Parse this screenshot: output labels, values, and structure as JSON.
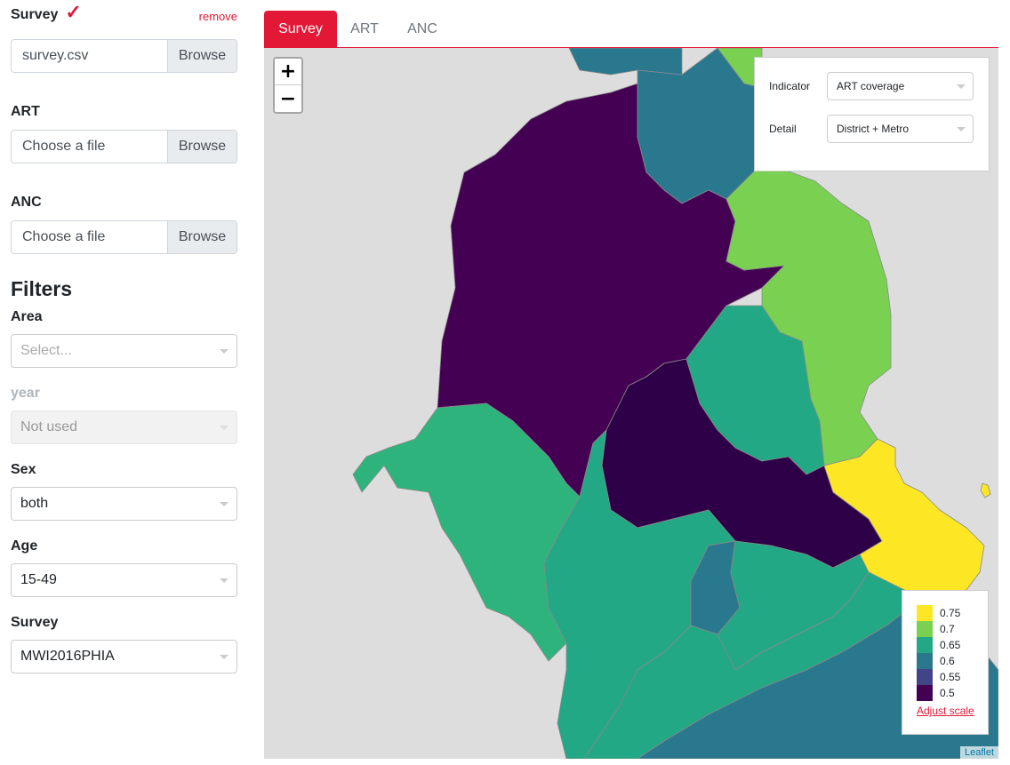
{
  "sidebar": {
    "survey": {
      "title": "Survey",
      "check": "✓",
      "remove": "remove",
      "file": "survey.csv",
      "browse": "Browse"
    },
    "art": {
      "title": "ART",
      "file": "Choose a file",
      "browse": "Browse"
    },
    "anc": {
      "title": "ANC",
      "file": "Choose a file",
      "browse": "Browse"
    },
    "filters_title": "Filters",
    "filters": {
      "area": {
        "label": "Area",
        "placeholder": "Select..."
      },
      "year": {
        "label": "year",
        "value": "Not used"
      },
      "sex": {
        "label": "Sex",
        "value": "both"
      },
      "age": {
        "label": "Age",
        "value": "15-49"
      },
      "survey": {
        "label": "Survey",
        "value": "MWI2016PHIA"
      }
    }
  },
  "tabs": [
    {
      "label": "Survey",
      "active": true
    },
    {
      "label": "ART",
      "active": false
    },
    {
      "label": "ANC",
      "active": false
    }
  ],
  "map": {
    "zoom_in": "+",
    "zoom_out": "−",
    "controls": {
      "indicator_label": "Indicator",
      "indicator_value": "ART coverage",
      "detail_label": "Detail",
      "detail_value": "District + Metro"
    },
    "legend": {
      "items": [
        {
          "label": "0.75",
          "color": "#fde725"
        },
        {
          "label": "0.7",
          "color": "#7ad151"
        },
        {
          "label": "0.65",
          "color": "#22a884"
        },
        {
          "label": "0.6",
          "color": "#2a788e"
        },
        {
          "label": "0.55",
          "color": "#414487"
        },
        {
          "label": "0.5",
          "color": "#440154"
        }
      ],
      "adjust_link": "Adjust scale"
    },
    "attribution": "Leaflet"
  }
}
